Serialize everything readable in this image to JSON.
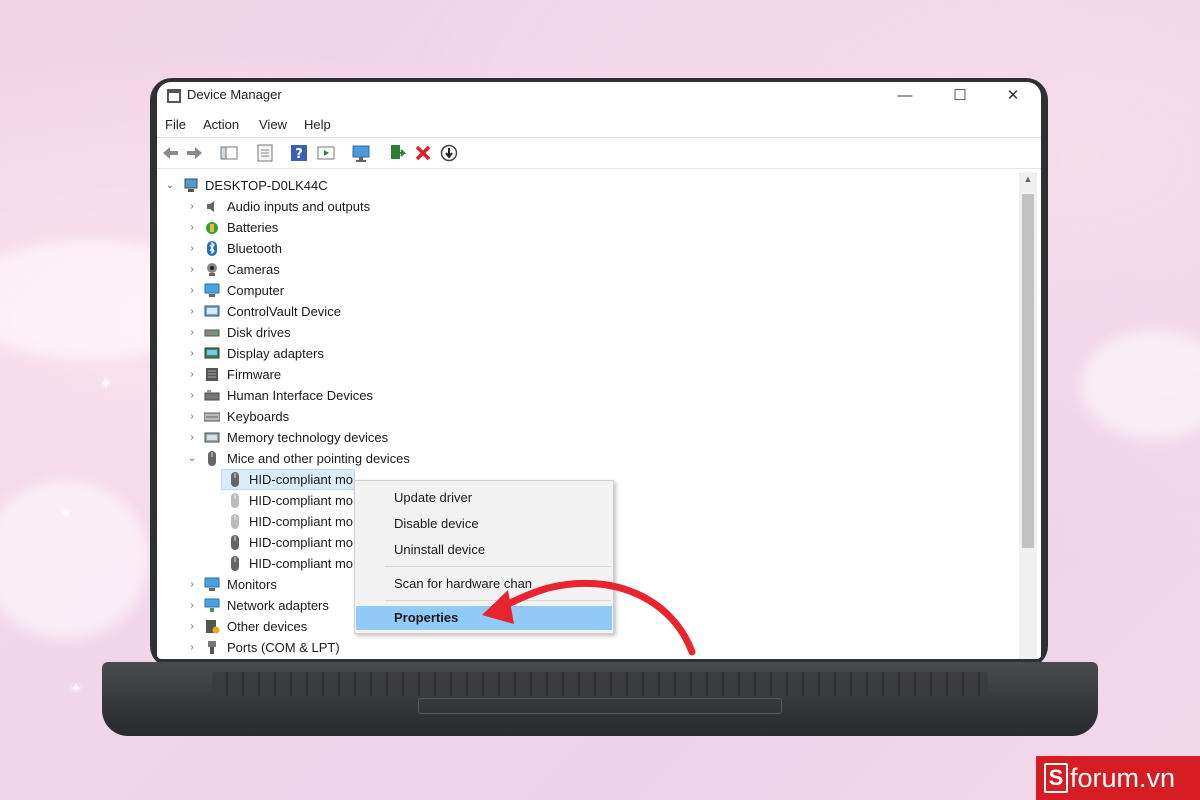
{
  "window": {
    "title": "Device Manager",
    "minimize": "—",
    "maximize": "☐",
    "close": "✕"
  },
  "menu": [
    "File",
    "Action",
    "View",
    "Help"
  ],
  "tree": {
    "root": "DESKTOP-D0LK44C",
    "categories": [
      "Audio inputs and outputs",
      "Batteries",
      "Bluetooth",
      "Cameras",
      "Computer",
      "ControlVault Device",
      "Disk drives",
      "Display adapters",
      "Firmware",
      "Human Interface Devices",
      "Keyboards",
      "Memory technology devices",
      "Mice and other pointing devices"
    ],
    "mice_children": [
      "HID-compliant mo",
      "HID-compliant mo",
      "HID-compliant mo",
      "HID-compliant mo",
      "HID-compliant mo"
    ],
    "after": [
      "Monitors",
      "Network adapters",
      "Other devices",
      "Ports (COM & LPT)"
    ]
  },
  "context_menu": {
    "update": "Update driver",
    "disable": "Disable device",
    "uninstall": "Uninstall device",
    "scan": "Scan for hardware chan",
    "properties": "Properties"
  },
  "logo": {
    "mark": "S",
    "text": "forum.vn"
  },
  "colors": {
    "selection": "#dcebfa",
    "menu_highlight": "#91c9f7",
    "annotation_arrow": "#e8242e",
    "brand": "#d71d24"
  }
}
